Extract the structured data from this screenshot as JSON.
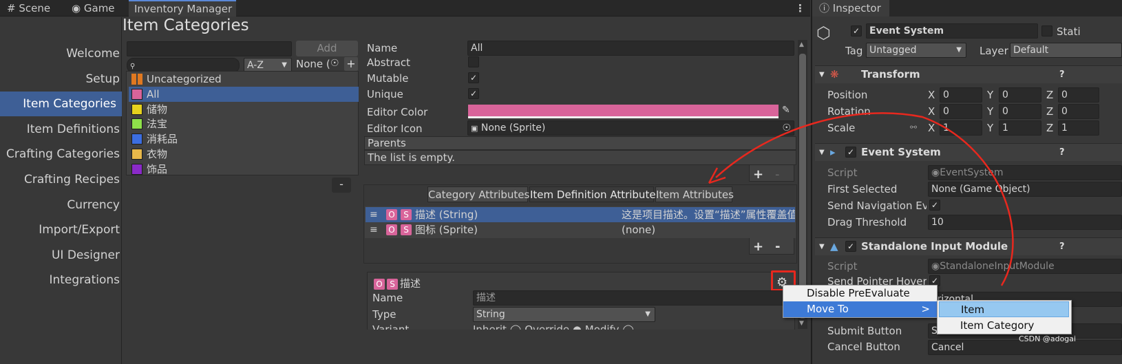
{
  "tabs": {
    "scene": "Scene",
    "game": "Game",
    "inventory": "Inventory Manager",
    "inspector": "Inspector"
  },
  "heading": "Item Categories",
  "nav": [
    "Welcome",
    "Setup",
    "Item Categories",
    "Item Definitions",
    "Crafting Categories",
    "Crafting Recipes",
    "Currency",
    "Import/Export",
    "UI Designer",
    "Integrations"
  ],
  "nav_selected": 2,
  "category_list": {
    "add_label": "Add",
    "sort_value": "A-Z",
    "filter_value": "None (",
    "plus": "+",
    "minus": "-",
    "items": [
      {
        "name": "Uncategorized",
        "color": "#e07820"
      },
      {
        "name": "All",
        "color": "#d8649a"
      },
      {
        "name": "储物",
        "color": "#e6d21e"
      },
      {
        "name": "法宝",
        "color": "#8ee04a"
      },
      {
        "name": "消耗品",
        "color": "#3c6ee0"
      },
      {
        "name": "衣物",
        "color": "#e8b84a"
      },
      {
        "name": "饰品",
        "color": "#8a2ac8"
      }
    ]
  },
  "details": {
    "name_label": "Name",
    "name_value": "All",
    "abstract_label": "Abstract",
    "mutable_label": "Mutable",
    "unique_label": "Unique",
    "editor_color_label": "Editor Color",
    "editor_color": "#d8649a",
    "editor_icon_label": "Editor Icon",
    "editor_icon_value": "None (Sprite)",
    "parents_label": "Parents",
    "parents_empty": "The list is empty.",
    "plus": "+",
    "minus": "-",
    "attr_tabs": [
      "Category Attributes",
      "Item Definition Attributes",
      "Item Attributes"
    ],
    "attributes": [
      {
        "name": "描述 (String)",
        "value": "这是项目描述。设置“描述”属性覆盖值以"
      },
      {
        "name": "图标 (Sprite)",
        "value": "(none)"
      }
    ],
    "o": "O",
    "s": "S",
    "selected_attr": {
      "title": "描述",
      "name_label": "Name",
      "name_value": "描述",
      "type_label": "Type",
      "type_value": "String",
      "variant_label": "Variant",
      "variant_options": [
        "Inherit",
        "Override",
        "Modify"
      ]
    }
  },
  "context_menu": {
    "disable": "Disable PreEvaluate",
    "move_to": "Move To",
    "arrow": ">",
    "submenu": [
      "Item",
      "Item Category"
    ]
  },
  "inspector": {
    "object_name": "Event System",
    "static_label": "Stati",
    "tag_label": "Tag",
    "tag_value": "Untagged",
    "layer_label": "Layer",
    "layer_value": "Default",
    "transform": {
      "title": "Transform",
      "position_label": "Position",
      "rotation_label": "Rotation",
      "scale_label": "Scale",
      "position": [
        "0",
        "0",
        "0"
      ],
      "rotation": [
        "0",
        "0",
        "0"
      ],
      "scale": [
        "1",
        "1",
        "1"
      ],
      "axes": [
        "X",
        "Y",
        "Z"
      ]
    },
    "event_system": {
      "title": "Event System",
      "script_label": "Script",
      "script_value": "EventSystem",
      "first_selected_label": "First Selected",
      "first_selected_value": "None (Game Object)",
      "send_nav_label": "Send Navigation Eve",
      "drag_label": "Drag Threshold",
      "drag_value": "10"
    },
    "input_module": {
      "title": "Standalone Input Module",
      "script_label": "Script",
      "script_value": "StandaloneInputModule",
      "hover_label": "Send Pointer Hover T",
      "horizontal_value": "orizontal",
      "submit_label": "Submit Button",
      "submit_value": "S",
      "cancel_label": "Cancel Button",
      "cancel_value": "Cancel"
    },
    "help": "?"
  },
  "watermark": "CSDN @adogai",
  "colors": {
    "selection": "#3e5f96",
    "annotation": "#e8281e",
    "menu_highlight": "#3d7ad6",
    "submenu_highlight": "#96c8f0"
  }
}
